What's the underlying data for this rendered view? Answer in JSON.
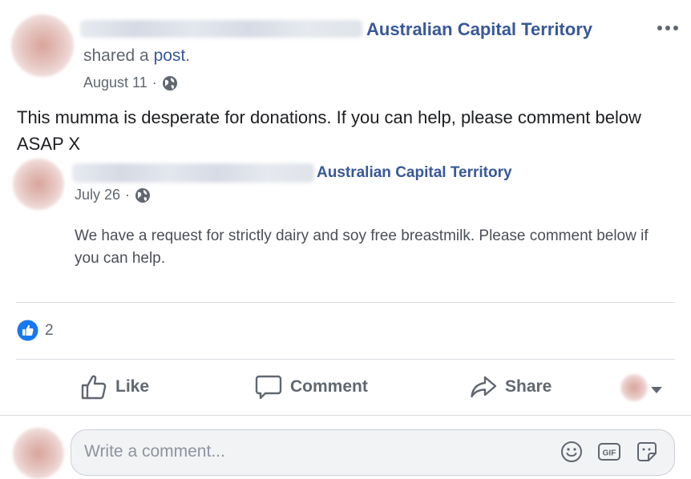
{
  "post": {
    "page_name": "Australian Capital Territory",
    "shared_text": "shared a",
    "shared_link": "post",
    "shared_period": ".",
    "date": "August 11",
    "separator": "·",
    "body": "This mumma is desperate for donations. If you can help, please comment below ASAP X",
    "more_icon": "more-options-icon"
  },
  "shared_post": {
    "page_name": "Australian Capital Territory",
    "date": "July 26",
    "separator": "·",
    "body": "We have a request for strictly dairy and soy free breastmilk. Please comment below if you can help."
  },
  "reactions": {
    "count": "2",
    "icon": "like-reaction-icon"
  },
  "actions": {
    "like": "Like",
    "comment": "Comment",
    "share": "Share"
  },
  "comment_composer": {
    "placeholder": "Write a comment...",
    "icons": [
      "emoji-icon",
      "gif-icon",
      "sticker-icon"
    ]
  },
  "colors": {
    "link": "#385898",
    "text": "#1c1e21",
    "secondary": "#606770",
    "like_blue": "#1877f2",
    "divider": "#dadde1"
  }
}
